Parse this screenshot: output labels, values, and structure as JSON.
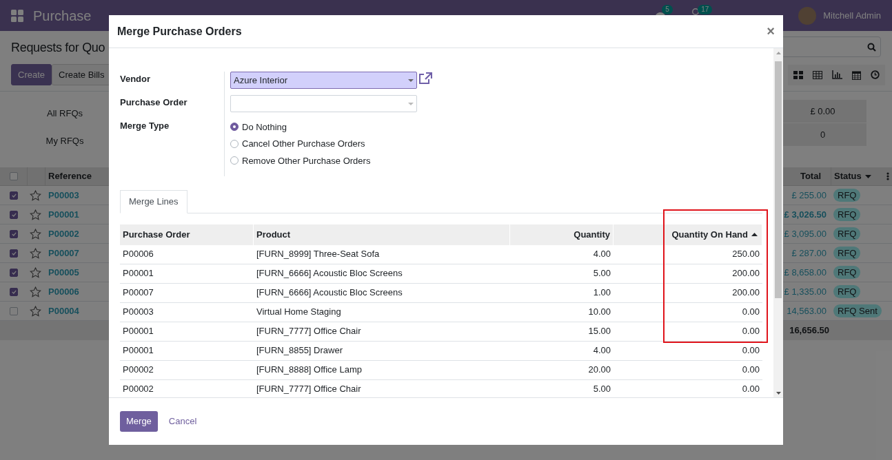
{
  "navbar": {
    "app_title": "Purchase",
    "messages_count": "5",
    "activities_count": "17",
    "user": "Mitchell Admin"
  },
  "control_panel": {
    "breadcrumb": "Requests for Quo",
    "buttons": [
      {
        "label": "Create",
        "kind": "primary"
      },
      {
        "label": "Create Bills",
        "kind": "secondary"
      }
    ]
  },
  "dashboard": {
    "filters": [
      "All RFQs",
      "My RFQs"
    ],
    "values": [
      "£ 0.00",
      "0"
    ]
  },
  "list": {
    "select_all_checked": false,
    "reference_header": "Reference",
    "total_header": "Total",
    "status_header": "Status",
    "rows": [
      {
        "checked": true,
        "reference": "P00003",
        "total": "£ 255.00",
        "emphasized": false,
        "status": "RFQ"
      },
      {
        "checked": true,
        "reference": "P00001",
        "total": "£ 3,026.50",
        "emphasized": true,
        "status": "RFQ"
      },
      {
        "checked": true,
        "reference": "P00002",
        "total": "£ 3,095.00",
        "emphasized": false,
        "status": "RFQ"
      },
      {
        "checked": true,
        "reference": "P00007",
        "total": "£ 287.00",
        "emphasized": false,
        "status": "RFQ"
      },
      {
        "checked": true,
        "reference": "P00005",
        "total": "£ 8,658.00",
        "emphasized": false,
        "status": "RFQ"
      },
      {
        "checked": true,
        "reference": "P00006",
        "total": "£ 1,335.00",
        "emphasized": false,
        "status": "RFQ"
      },
      {
        "checked": false,
        "reference": "P00004",
        "total": "14,563.00",
        "emphasized": false,
        "status": "RFQ Sent"
      }
    ],
    "grand_total": "16,656.50"
  },
  "dialog": {
    "title": "Merge Purchase Orders",
    "close": "×",
    "fields": [
      {
        "label": "Vendor",
        "kind": "select",
        "value": "Azure Interior",
        "highlighted": true
      },
      {
        "label": "Purchase Order",
        "kind": "select",
        "highlighted": false
      },
      {
        "label": "Merge Type",
        "kind": "radio",
        "options": [
          {
            "label": "Do Nothing",
            "selected": true
          },
          {
            "label": "Cancel Other Purchase Orders",
            "selected": false
          },
          {
            "label": "Remove Other Purchase Orders",
            "selected": false
          }
        ]
      }
    ],
    "tabs": [
      {
        "label": "Merge Lines",
        "selected": true
      }
    ],
    "table": {
      "columns": [
        {
          "label": "Purchase Order",
          "kind": "text",
          "sorted": false
        },
        {
          "label": "Product",
          "kind": "text",
          "sorted": false
        },
        {
          "label": "Quantity",
          "kind": "number",
          "sorted": false
        },
        {
          "label": "Quantity On Hand",
          "kind": "number",
          "sorted": true
        }
      ],
      "rows": [
        [
          "P00006",
          "[FURN_8999] Three-Seat Sofa",
          "4.00",
          "250.00"
        ],
        [
          "P00001",
          "[FURN_6666] Acoustic Bloc Screens",
          "5.00",
          "200.00"
        ],
        [
          "P00007",
          "[FURN_6666] Acoustic Bloc Screens",
          "1.00",
          "200.00"
        ],
        [
          "P00003",
          "Virtual Home Staging",
          "10.00",
          "0.00"
        ],
        [
          "P00001",
          "[FURN_7777] Office Chair",
          "15.00",
          "0.00"
        ],
        [
          "P00001",
          "[FURN_8855] Drawer",
          "4.00",
          "0.00"
        ],
        [
          "P00002",
          "[FURN_8888] Office Lamp",
          "20.00",
          "0.00"
        ],
        [
          "P00002",
          "[FURN_7777] Office Chair",
          "5.00",
          "0.00"
        ]
      ]
    },
    "buttons": [
      {
        "label": "Merge",
        "kind": "primary"
      },
      {
        "label": "Cancel",
        "kind": "link"
      }
    ]
  }
}
